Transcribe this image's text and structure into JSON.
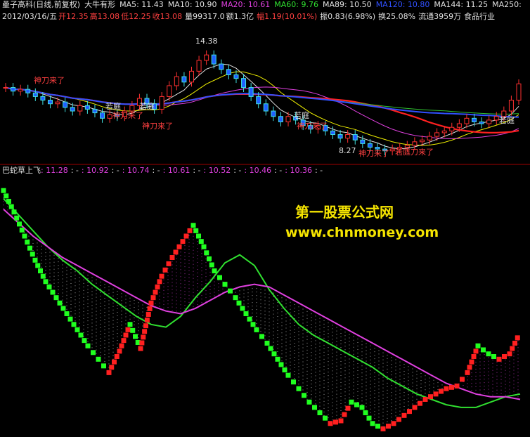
{
  "header": {
    "title": "曐子高科(日线,前复权)",
    "subtitle": "大牛有形",
    "ma": [
      {
        "label": "MA5: 11.43",
        "color": "#e0e0e0"
      },
      {
        "label": "MA10: 10.90",
        "color": "#e0e0e0"
      },
      {
        "label": "MA20: 10.61",
        "color": "#e040e0"
      },
      {
        "label": "MA60: 9.76",
        "color": "#30e030"
      },
      {
        "label": "MA89: 10.50",
        "color": "#e0e0e0"
      },
      {
        "label": "MA120: 10.80",
        "color": "#3050ff"
      },
      {
        "label": "MA144: 11.25",
        "color": "#e0e0e0"
      },
      {
        "label": "MA250:",
        "color": "#e0e0e0"
      }
    ]
  },
  "quote": {
    "date": "2012/03/16/五",
    "open": "开12.35",
    "high": "高13.08",
    "low": "低12.25",
    "close": "收13.08",
    "volume": "量99317.0",
    "amount": "额1.3亿",
    "change": "幅1.19(10.01%)",
    "amplitude": "振0.83(6.98%)",
    "turnover": "换25.08%",
    "float": "流通3959万",
    "industry": "食品行业"
  },
  "indicator": {
    "name": "巴蛇草上飞",
    "values": [
      ": 11.28",
      ": -",
      ": 10.92",
      ": -",
      ": 10.74",
      ": -",
      ": 10.61",
      ": -",
      ": 10.52",
      ": -",
      ": 10.46",
      ": -",
      ": 10.36",
      ": -"
    ]
  },
  "watermark": {
    "line1": "第一股票公式网",
    "line2": "www.chnmoney.com"
  },
  "chart_data": {
    "type": "line",
    "annotations": {
      "peak_price": "14.38",
      "low_price": "8.27",
      "ruoting": "若庭",
      "shendao": "神刀来了",
      "ruoting_shendao": "若庭刀来了"
    },
    "price_close": [
      11.9,
      11.7,
      11.8,
      11.6,
      11.4,
      11.2,
      11.0,
      11.1,
      10.8,
      10.6,
      10.9,
      10.7,
      10.5,
      10.2,
      10.4,
      10.3,
      10.6,
      10.9,
      11.3,
      11.0,
      10.7,
      11.4,
      12.0,
      12.5,
      12.2,
      12.8,
      13.4,
      13.7,
      13.2,
      12.9,
      12.6,
      12.4,
      11.9,
      11.4,
      11.0,
      10.6,
      10.3,
      10.0,
      10.3,
      10.1,
      9.8,
      9.6,
      9.8,
      9.5,
      9.3,
      9.1,
      9.3,
      9.0,
      8.8,
      8.6,
      8.5,
      8.4,
      8.5,
      8.6,
      8.7,
      8.9,
      9.0,
      9.2,
      9.4,
      9.5,
      9.7,
      9.9,
      10.2,
      10.0,
      9.9,
      10.1,
      10.3,
      10.6,
      11.2,
      12.1
    ],
    "bands": {
      "series": [
        {
          "name": "upper",
          "values": [
            13.3,
            12.7,
            12.1,
            11.5,
            11.0,
            10.6,
            10.1,
            9.7,
            9.3,
            8.9,
            8.6,
            8.5,
            8.9,
            9.6,
            10.2,
            10.9,
            11.2,
            10.8,
            9.9,
            9.2,
            8.6,
            8.2,
            7.9,
            7.6,
            7.3,
            7.0,
            6.6,
            6.3,
            6.0,
            5.8,
            5.6,
            5.5,
            5.5,
            5.7,
            5.9,
            6.0
          ]
        },
        {
          "name": "lower",
          "values": [
            12.9,
            12.4,
            11.9,
            11.5,
            11.1,
            10.8,
            10.5,
            10.2,
            9.9,
            9.6,
            9.3,
            9.1,
            9.0,
            9.2,
            9.5,
            9.8,
            10.0,
            10.1,
            10.0,
            9.7,
            9.4,
            9.1,
            8.8,
            8.5,
            8.2,
            7.9,
            7.6,
            7.3,
            7.0,
            6.7,
            6.4,
            6.2,
            6.0,
            5.9,
            5.9,
            5.8
          ]
        },
        {
          "name": "fast",
          "values": [
            13.6,
            12.8,
            11.9,
            11.0,
            10.2,
            9.6,
            9.0,
            8.4,
            7.8,
            7.3,
            6.8,
            7.6,
            8.6,
            7.7,
            9.4,
            10.4,
            11.1,
            11.7,
            12.3,
            11.5,
            10.6,
            10.1,
            9.6,
            9.0,
            8.4,
            7.9,
            7.3,
            6.7,
            6.2,
            5.7,
            5.3,
            4.9,
            5.0,
            5.7,
            5.5,
            4.9,
            4.7,
            4.9,
            5.2,
            5.5,
            5.8,
            6.0,
            6.2,
            6.3,
            6.8,
            7.8,
            7.5,
            7.3,
            7.5,
            8.3
          ]
        }
      ]
    }
  }
}
